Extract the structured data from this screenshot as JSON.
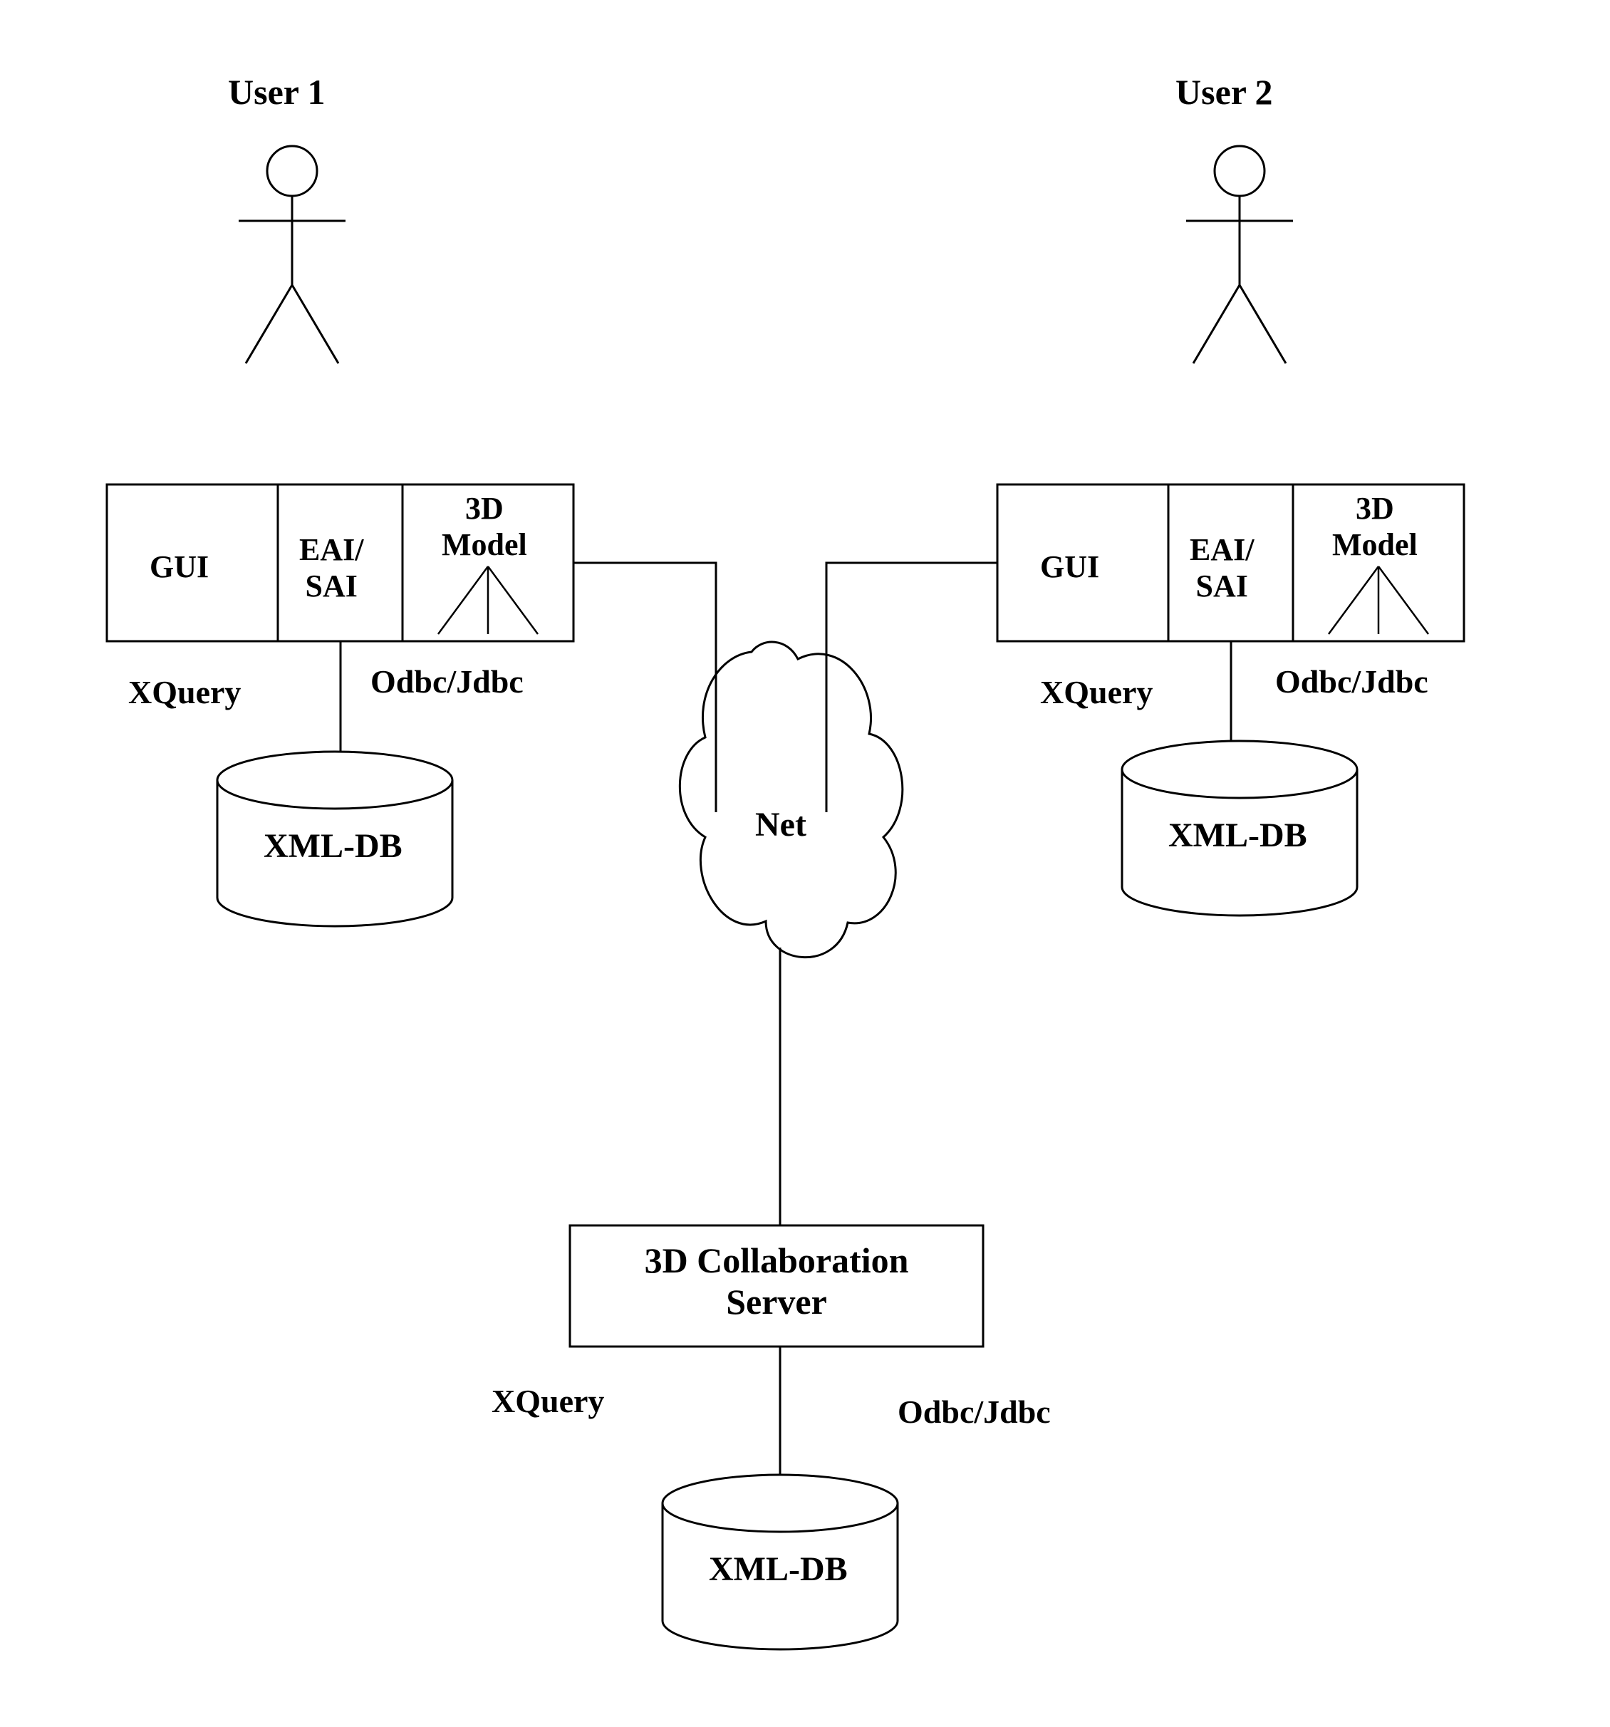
{
  "users": {
    "user1": {
      "label": "User 1"
    },
    "user2": {
      "label": "User 2"
    }
  },
  "client1": {
    "gui": "GUI",
    "eai_sai": "EAI/\nSAI",
    "model": "3D\nModel",
    "xquery": "XQuery",
    "odbc": "Odbc/Jdbc",
    "db": "XML-DB"
  },
  "client2": {
    "gui": "GUI",
    "eai_sai": "EAI/\nSAI",
    "model": "3D\nModel",
    "xquery": "XQuery",
    "odbc": "Odbc/Jdbc",
    "db": "XML-DB"
  },
  "net": {
    "label": "Net"
  },
  "server": {
    "label": "3D Collaboration\nServer",
    "xquery": "XQuery",
    "odbc": "Odbc/Jdbc",
    "db": "XML-DB"
  }
}
